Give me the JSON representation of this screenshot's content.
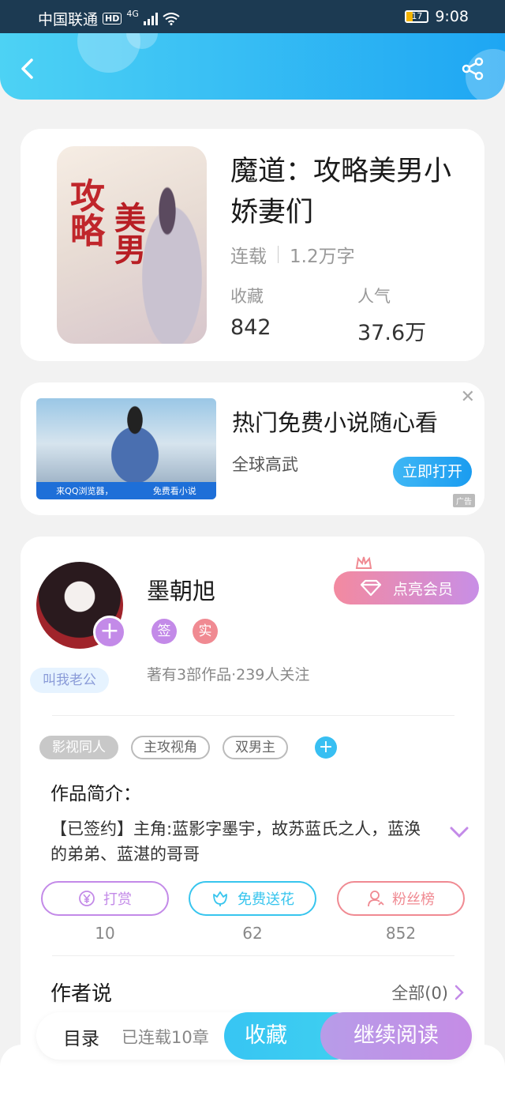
{
  "status": {
    "carrier": "中国联通",
    "hd": "HD",
    "network": "4G",
    "battery": "17",
    "time": "9:08"
  },
  "header": {
    "back_icon": "back-arrow-icon",
    "share_icon": "share-icon"
  },
  "book": {
    "title": "魔道：攻略美男小娇妻们",
    "status": "连载",
    "words": "1.2万字",
    "fav_label": "收藏",
    "fav_value": "842",
    "pop_label": "人气",
    "pop_value": "37.6万"
  },
  "ad": {
    "title": "热门免费小说随心看",
    "subtitle": "全球高武",
    "button": "立即打开",
    "tag": "广告",
    "banner_left": "来QQ浏览器，",
    "banner_right": "免费看小说"
  },
  "author": {
    "name": "墨朝旭",
    "badge1": "签",
    "badge2": "实",
    "stats": "著有3部作品·239人关注",
    "nickname": "叫我老公",
    "vip_label": "点亮会员"
  },
  "tags": [
    "影视同人",
    "主攻视角",
    "双男主"
  ],
  "intro": {
    "heading": "作品简介：",
    "text": "【已签约】主角:蓝影字墨宇，故苏蓝氏之人，蓝涣的弟弟、蓝湛的哥哥"
  },
  "actions": [
    {
      "label": "打赏",
      "value": "10",
      "color": "#c38ae8"
    },
    {
      "label": "免费送花",
      "value": "62",
      "color": "#38c5ee"
    },
    {
      "label": "粉丝榜",
      "value": "852",
      "color": "#f08a92"
    }
  ],
  "author_say": {
    "heading": "作者说",
    "all": "全部(0)"
  },
  "bottom": {
    "toc": "目录",
    "progress": "已连载10章",
    "fav": "收藏",
    "read": "继续阅读"
  }
}
